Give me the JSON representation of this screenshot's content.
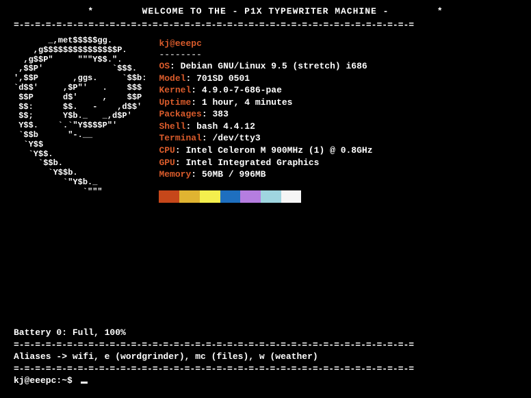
{
  "header": {
    "left_star": "*",
    "text": "WELCOME TO THE - P1X TYPEWRITER MACHINE -",
    "right_star": "*"
  },
  "rule": "=-=-=-=-=-=-=-=-=-=-=-=-=-=-=-=-=-=-=-=-=-=-=-=-=-=-=-=-=-=-=-=-=-=-=-=-=-=",
  "ascii_logo": "       _,met$$$$$gg.\n    ,g$$$$$$$$$$$$$$$P.\n  ,g$$P\"     \"\"\"Y$$.\".\n ,$$P'              `$$$.\n',$$P       ,ggs.     `$$b:\n`d$$'     ,$P\"'   .    $$$\n $$P      d$'     ,    $$P\n $$:      $$.   -    ,d$$'\n $$;      Y$b._   _,d$P'\n Y$$.    `.`\"Y$$$$P\"'\n `$$b      \"-.__\n  `Y$$\n   `Y$$.\n     `$$b.\n       `Y$$b.\n          `\"Y$b._\n              `\"\"\"",
  "userhost": {
    "user": "kj",
    "at": "@",
    "host": "eeepc",
    "underline": "--------"
  },
  "info": {
    "os": {
      "label": "OS",
      "value": "Debian GNU/Linux 9.5 (stretch) i686"
    },
    "model": {
      "label": "Model",
      "value": "701SD 0501"
    },
    "kernel": {
      "label": "Kernel",
      "value": "4.9.0-7-686-pae"
    },
    "uptime": {
      "label": "Uptime",
      "value": "1 hour, 4 minutes"
    },
    "packages": {
      "label": "Packages",
      "value": "383"
    },
    "shell": {
      "label": "Shell",
      "value": "bash 4.4.12"
    },
    "terminal": {
      "label": "Terminal",
      "value": "/dev/tty3"
    },
    "cpu": {
      "label": "CPU",
      "value": "Intel Celeron M 900MHz (1) @ 0.8GHz"
    },
    "gpu": {
      "label": "GPU",
      "value": "Intel Integrated Graphics"
    },
    "memory": {
      "label": "Memory",
      "value": "50MB / 996MB"
    }
  },
  "battery": "Battery 0: Full, 100%",
  "aliases": "Aliases -> wifi, e (wordgrinder), mc (files), w (weather)",
  "prompt": "kj@eeepc:~$ "
}
